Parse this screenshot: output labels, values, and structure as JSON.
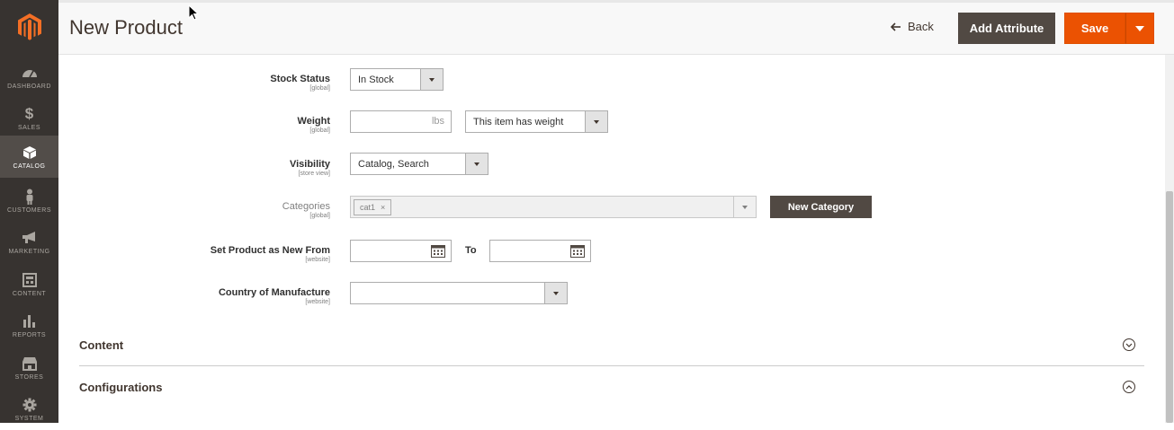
{
  "sidebar": {
    "items": [
      {
        "label": "DASHBOARD",
        "icon": "dashboard-icon"
      },
      {
        "label": "SALES",
        "icon": "dollar-icon"
      },
      {
        "label": "CATALOG",
        "icon": "box-icon",
        "active": true
      },
      {
        "label": "CUSTOMERS",
        "icon": "person-icon"
      },
      {
        "label": "MARKETING",
        "icon": "megaphone-icon"
      },
      {
        "label": "CONTENT",
        "icon": "content-icon"
      },
      {
        "label": "REPORTS",
        "icon": "bar-chart-icon"
      },
      {
        "label": "STORES",
        "icon": "store-icon"
      },
      {
        "label": "SYSTEM",
        "icon": "gear-icon"
      }
    ]
  },
  "header": {
    "title": "New Product",
    "back_label": "Back",
    "add_attribute_label": "Add Attribute",
    "save_label": "Save"
  },
  "form": {
    "stock_status": {
      "label": "Stock Status",
      "scope": "[global]",
      "value": "In Stock"
    },
    "weight": {
      "label": "Weight",
      "scope": "[global]",
      "value": "",
      "unit": "lbs",
      "has_weight": "This item has weight"
    },
    "visibility": {
      "label": "Visibility",
      "scope": "[store view]",
      "value": "Catalog, Search"
    },
    "categories": {
      "label": "Categories",
      "scope": "[global]",
      "tag": "cat1",
      "tag_remove": "×",
      "new_category_label": "New Category"
    },
    "new_from": {
      "label": "Set Product as New From",
      "scope": "[website]",
      "from_value": "",
      "to_label": "To",
      "to_value": ""
    },
    "country": {
      "label": "Country of Manufacture",
      "scope": "[website]",
      "value": ""
    }
  },
  "sections": [
    {
      "title": "Content",
      "state": "collapsed"
    },
    {
      "title": "Configurations",
      "state": "expanded"
    }
  ],
  "colors": {
    "sidebar_bg": "#373330",
    "accent": "#eb5202",
    "secondary_button": "#514943",
    "logo": "#f46f25"
  }
}
